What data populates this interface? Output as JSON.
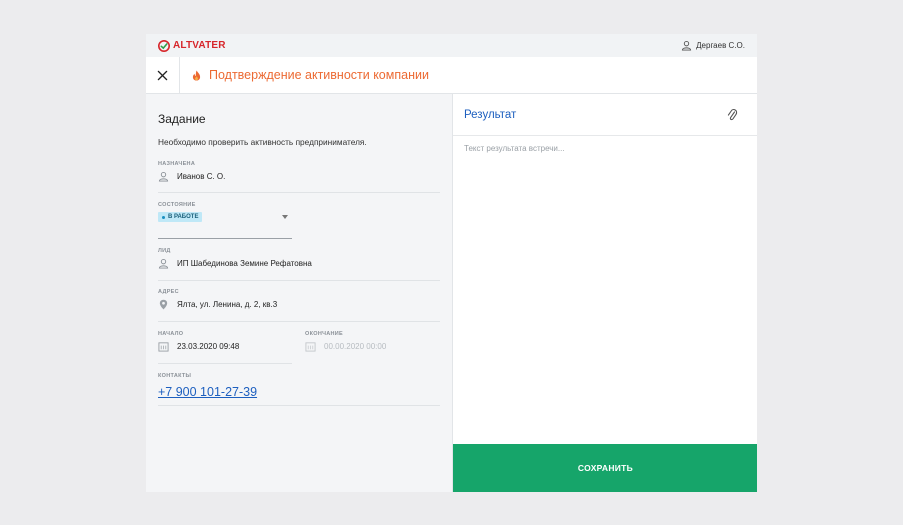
{
  "brand": {
    "name": "ALTVATER",
    "color": "#d7262b"
  },
  "user": {
    "name": "Дергаев С.О.",
    "icon": "user-icon"
  },
  "header": {
    "title": "Подтверждение активности компании",
    "title_color": "#ec6a33",
    "close_icon": "close-icon",
    "flame_icon": "flame-icon"
  },
  "task": {
    "title": "Задание",
    "description": "Необходимо проверить активность предпринимателя.",
    "assignee": {
      "label": "НАЗНАЧЕНА",
      "value": "Иванов С. О."
    },
    "status": {
      "label": "СОСТОЯНИЕ",
      "value": "В РАБОТЕ",
      "badge_color": "#bfe8f7"
    },
    "lead": {
      "label": "ЛИД",
      "value": "ИП Шабединова Земине Рефатовна"
    },
    "address": {
      "label": "АДРЕС",
      "value": "Ялта, ул. Ленина, д. 2, кв.3"
    },
    "start": {
      "label": "НАЧАЛО",
      "value": "23.03.2020 09:48"
    },
    "end": {
      "label": "ОКОНЧАНИЕ",
      "placeholder": "00.00.2020 00:00"
    },
    "contacts": {
      "label": "КОНТАКТЫ",
      "phone": "+7 900 101-27-39"
    }
  },
  "result": {
    "title": "Результат",
    "placeholder": "Текст результата встречи...",
    "attach_icon": "paperclip-icon"
  },
  "save_button": {
    "label": "СОХРАНИТЬ",
    "color": "#16a56a"
  }
}
